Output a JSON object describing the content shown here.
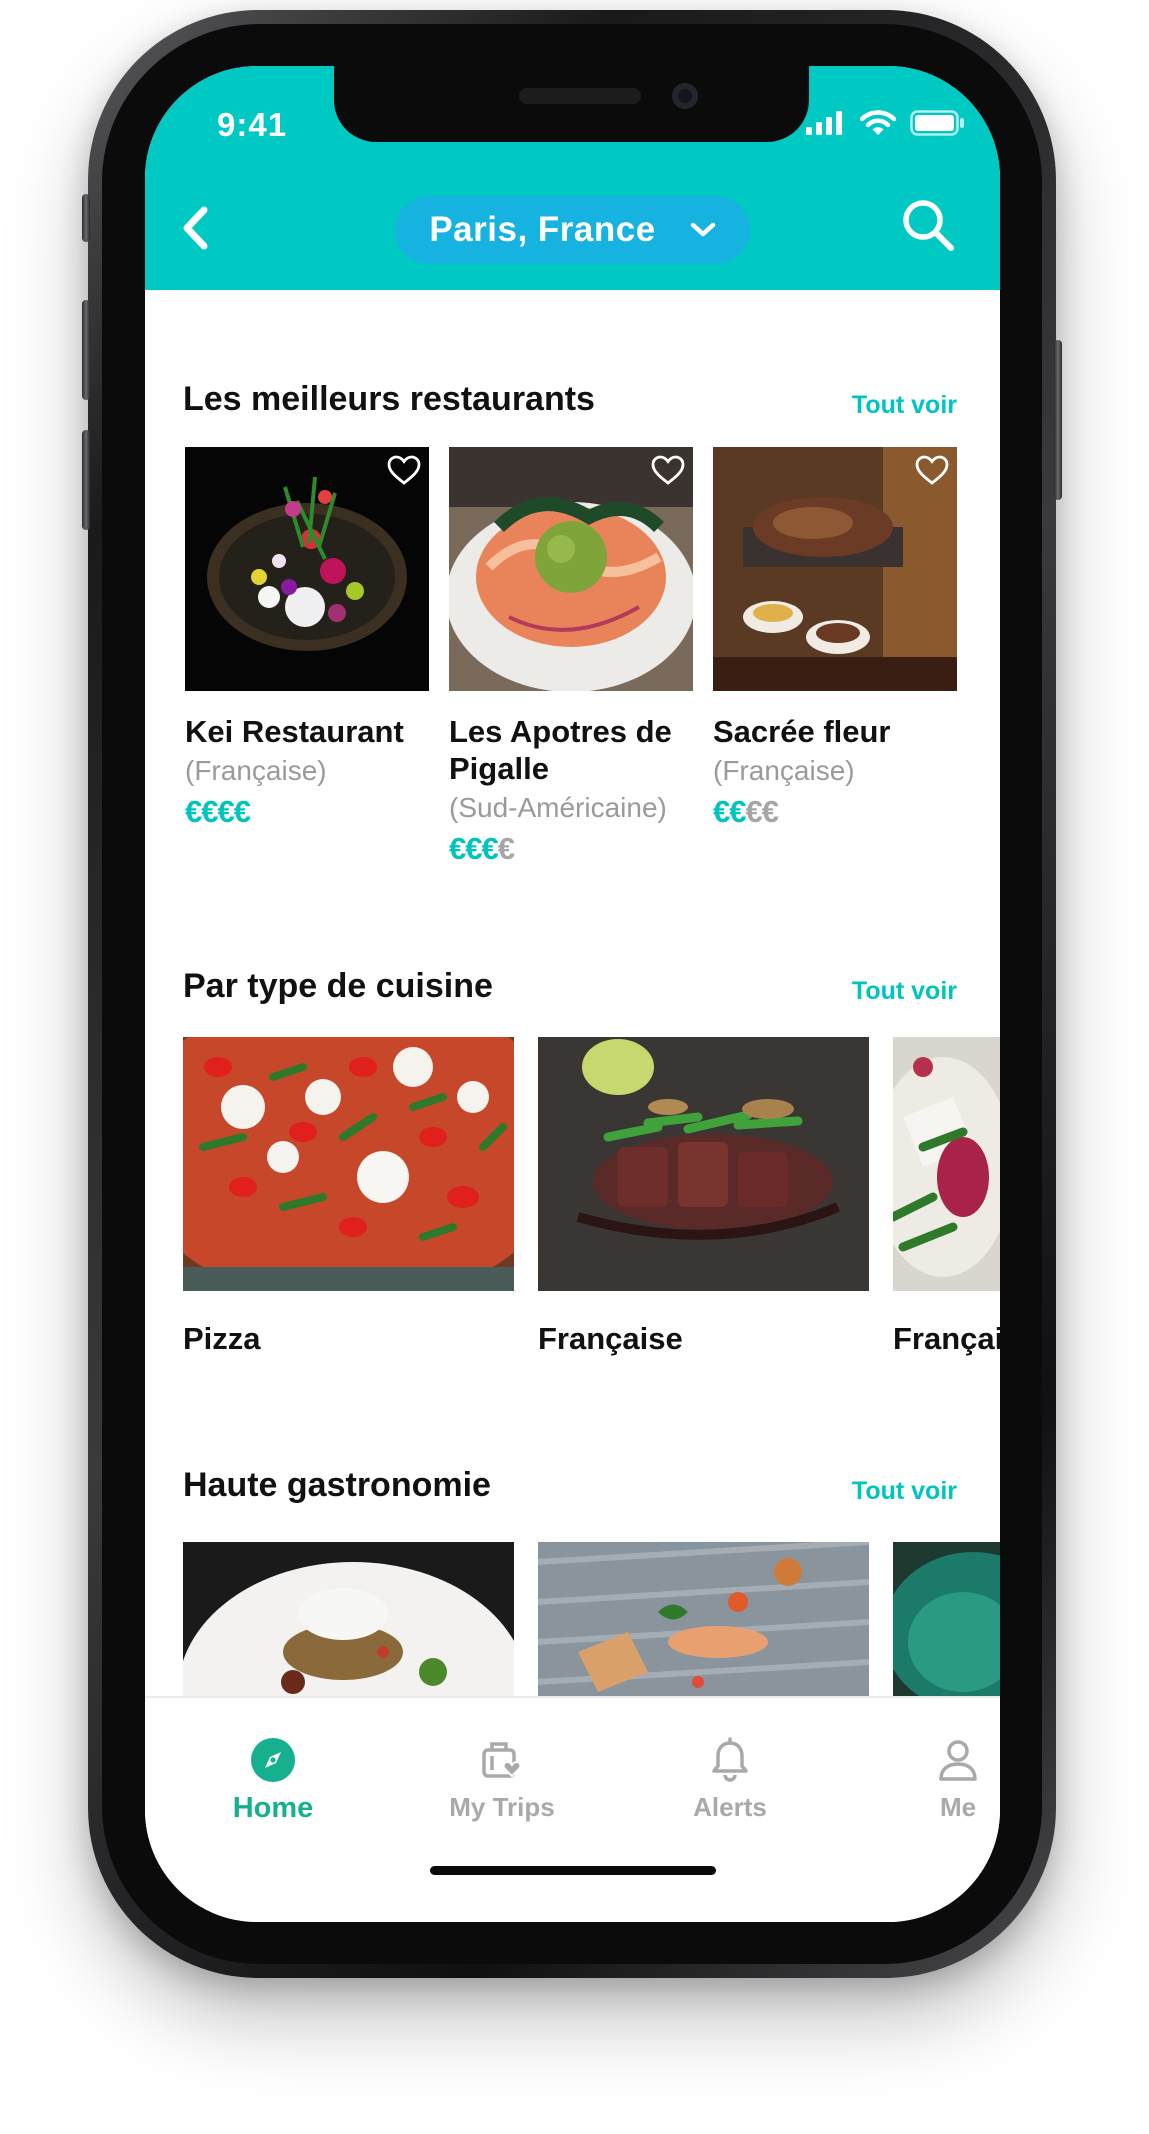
{
  "status_bar": {
    "time": "9:41"
  },
  "header": {
    "location": "Paris, France"
  },
  "sections": {
    "best": {
      "title": "Les meilleurs restaurants",
      "see_all": "Tout voir",
      "items": [
        {
          "name": "Kei Restaurant",
          "category": "(Française)",
          "price_on": "€€€€",
          "price_off": ""
        },
        {
          "name": "Les Apotres de Pigalle",
          "category": "(Sud-Américaine)",
          "price_on": "€€€",
          "price_off": "€"
        },
        {
          "name": "Sacrée fleur",
          "category": "(Française)",
          "price_on": "€€",
          "price_off": "€€"
        }
      ]
    },
    "cuisine": {
      "title": "Par type de cuisine",
      "see_all": "Tout voir",
      "items": [
        {
          "name": "Pizza"
        },
        {
          "name": "Française"
        },
        {
          "name": "Française"
        }
      ]
    },
    "gastro": {
      "title": "Haute gastronomie",
      "see_all": "Tout voir"
    }
  },
  "tabs": [
    {
      "label": "Home",
      "icon": "compass-icon",
      "active": true
    },
    {
      "label": "My Trips",
      "icon": "luggage-icon",
      "active": false
    },
    {
      "label": "Alerts",
      "icon": "bell-icon",
      "active": false
    },
    {
      "label": "Me",
      "icon": "user-icon",
      "active": false
    }
  ],
  "colors": {
    "accent": "#00c9c4",
    "pill": "#16b3e0",
    "active_tab": "#17b08f",
    "price": "#00c4be"
  }
}
